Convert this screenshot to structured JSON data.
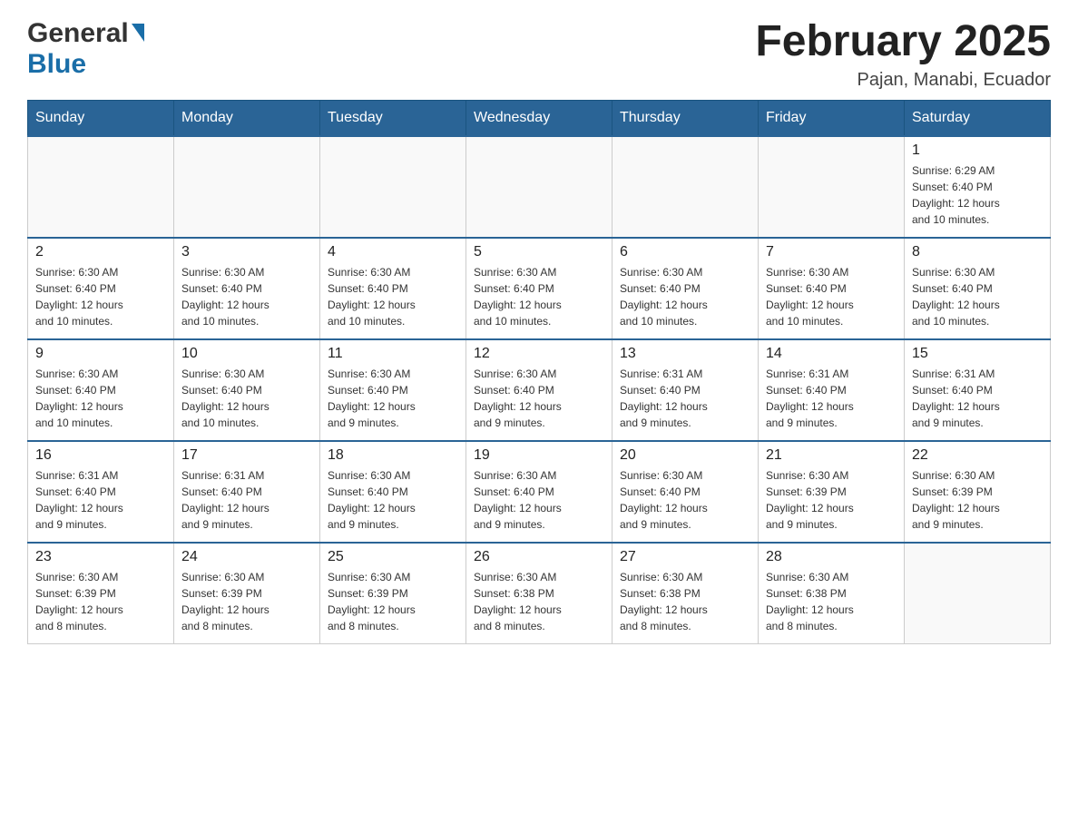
{
  "header": {
    "logo_general": "General",
    "logo_blue": "Blue",
    "month_year": "February 2025",
    "location": "Pajan, Manabi, Ecuador"
  },
  "weekdays": [
    "Sunday",
    "Monday",
    "Tuesday",
    "Wednesday",
    "Thursday",
    "Friday",
    "Saturday"
  ],
  "weeks": [
    [
      {
        "day": "",
        "info": ""
      },
      {
        "day": "",
        "info": ""
      },
      {
        "day": "",
        "info": ""
      },
      {
        "day": "",
        "info": ""
      },
      {
        "day": "",
        "info": ""
      },
      {
        "day": "",
        "info": ""
      },
      {
        "day": "1",
        "info": "Sunrise: 6:29 AM\nSunset: 6:40 PM\nDaylight: 12 hours\nand 10 minutes."
      }
    ],
    [
      {
        "day": "2",
        "info": "Sunrise: 6:30 AM\nSunset: 6:40 PM\nDaylight: 12 hours\nand 10 minutes."
      },
      {
        "day": "3",
        "info": "Sunrise: 6:30 AM\nSunset: 6:40 PM\nDaylight: 12 hours\nand 10 minutes."
      },
      {
        "day": "4",
        "info": "Sunrise: 6:30 AM\nSunset: 6:40 PM\nDaylight: 12 hours\nand 10 minutes."
      },
      {
        "day": "5",
        "info": "Sunrise: 6:30 AM\nSunset: 6:40 PM\nDaylight: 12 hours\nand 10 minutes."
      },
      {
        "day": "6",
        "info": "Sunrise: 6:30 AM\nSunset: 6:40 PM\nDaylight: 12 hours\nand 10 minutes."
      },
      {
        "day": "7",
        "info": "Sunrise: 6:30 AM\nSunset: 6:40 PM\nDaylight: 12 hours\nand 10 minutes."
      },
      {
        "day": "8",
        "info": "Sunrise: 6:30 AM\nSunset: 6:40 PM\nDaylight: 12 hours\nand 10 minutes."
      }
    ],
    [
      {
        "day": "9",
        "info": "Sunrise: 6:30 AM\nSunset: 6:40 PM\nDaylight: 12 hours\nand 10 minutes."
      },
      {
        "day": "10",
        "info": "Sunrise: 6:30 AM\nSunset: 6:40 PM\nDaylight: 12 hours\nand 10 minutes."
      },
      {
        "day": "11",
        "info": "Sunrise: 6:30 AM\nSunset: 6:40 PM\nDaylight: 12 hours\nand 9 minutes."
      },
      {
        "day": "12",
        "info": "Sunrise: 6:30 AM\nSunset: 6:40 PM\nDaylight: 12 hours\nand 9 minutes."
      },
      {
        "day": "13",
        "info": "Sunrise: 6:31 AM\nSunset: 6:40 PM\nDaylight: 12 hours\nand 9 minutes."
      },
      {
        "day": "14",
        "info": "Sunrise: 6:31 AM\nSunset: 6:40 PM\nDaylight: 12 hours\nand 9 minutes."
      },
      {
        "day": "15",
        "info": "Sunrise: 6:31 AM\nSunset: 6:40 PM\nDaylight: 12 hours\nand 9 minutes."
      }
    ],
    [
      {
        "day": "16",
        "info": "Sunrise: 6:31 AM\nSunset: 6:40 PM\nDaylight: 12 hours\nand 9 minutes."
      },
      {
        "day": "17",
        "info": "Sunrise: 6:31 AM\nSunset: 6:40 PM\nDaylight: 12 hours\nand 9 minutes."
      },
      {
        "day": "18",
        "info": "Sunrise: 6:30 AM\nSunset: 6:40 PM\nDaylight: 12 hours\nand 9 minutes."
      },
      {
        "day": "19",
        "info": "Sunrise: 6:30 AM\nSunset: 6:40 PM\nDaylight: 12 hours\nand 9 minutes."
      },
      {
        "day": "20",
        "info": "Sunrise: 6:30 AM\nSunset: 6:40 PM\nDaylight: 12 hours\nand 9 minutes."
      },
      {
        "day": "21",
        "info": "Sunrise: 6:30 AM\nSunset: 6:39 PM\nDaylight: 12 hours\nand 9 minutes."
      },
      {
        "day": "22",
        "info": "Sunrise: 6:30 AM\nSunset: 6:39 PM\nDaylight: 12 hours\nand 9 minutes."
      }
    ],
    [
      {
        "day": "23",
        "info": "Sunrise: 6:30 AM\nSunset: 6:39 PM\nDaylight: 12 hours\nand 8 minutes."
      },
      {
        "day": "24",
        "info": "Sunrise: 6:30 AM\nSunset: 6:39 PM\nDaylight: 12 hours\nand 8 minutes."
      },
      {
        "day": "25",
        "info": "Sunrise: 6:30 AM\nSunset: 6:39 PM\nDaylight: 12 hours\nand 8 minutes."
      },
      {
        "day": "26",
        "info": "Sunrise: 6:30 AM\nSunset: 6:38 PM\nDaylight: 12 hours\nand 8 minutes."
      },
      {
        "day": "27",
        "info": "Sunrise: 6:30 AM\nSunset: 6:38 PM\nDaylight: 12 hours\nand 8 minutes."
      },
      {
        "day": "28",
        "info": "Sunrise: 6:30 AM\nSunset: 6:38 PM\nDaylight: 12 hours\nand 8 minutes."
      },
      {
        "day": "",
        "info": ""
      }
    ]
  ]
}
